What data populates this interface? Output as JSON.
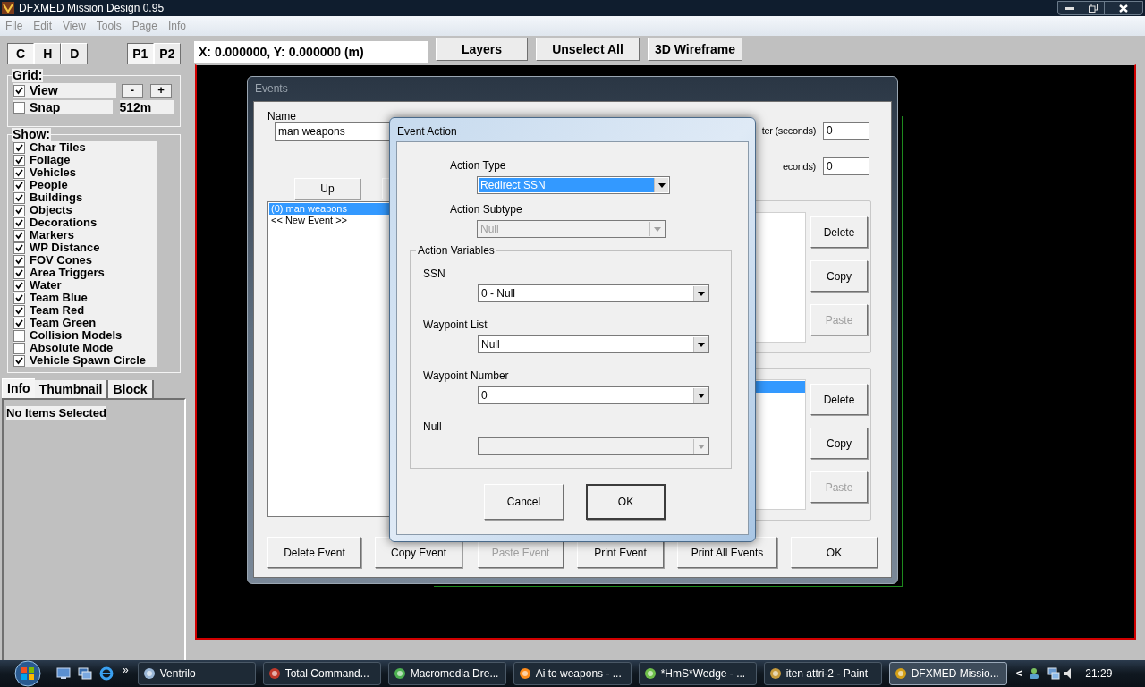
{
  "window": {
    "title": "DFXMED Mission Design 0.95"
  },
  "menu": [
    "File",
    "Edit",
    "View",
    "Tools",
    "Page",
    "Info"
  ],
  "modes": [
    {
      "label": "C",
      "selected": true
    },
    {
      "label": "H",
      "selected": false
    },
    {
      "label": "D",
      "selected": false
    }
  ],
  "pages": [
    {
      "label": "P1",
      "selected": true
    },
    {
      "label": "P2",
      "selected": false
    }
  ],
  "coordinates": "X: 0.000000, Y: 0.000000 (m)",
  "toolbar": [
    "Layers",
    "Unselect All",
    "3D Wireframe"
  ],
  "grid": {
    "title": "Grid:",
    "view": {
      "label": "View",
      "checked": true
    },
    "zoom_out": "-",
    "zoom_in": "+",
    "snap": {
      "label": "Snap",
      "checked": false
    },
    "size": "512m"
  },
  "show": {
    "title": "Show:",
    "items": [
      {
        "label": "Char Tiles",
        "checked": true
      },
      {
        "label": "Foliage",
        "checked": true
      },
      {
        "label": "Vehicles",
        "checked": true
      },
      {
        "label": "People",
        "checked": true
      },
      {
        "label": "Buildings",
        "checked": true
      },
      {
        "label": "Objects",
        "checked": true
      },
      {
        "label": "Decorations",
        "checked": true
      },
      {
        "label": "Markers",
        "checked": true
      },
      {
        "label": "WP Distance",
        "checked": true
      },
      {
        "label": "FOV Cones",
        "checked": true
      },
      {
        "label": "Area Triggers",
        "checked": true
      },
      {
        "label": "Water",
        "checked": true
      },
      {
        "label": "Team Blue",
        "checked": true
      },
      {
        "label": "Team Red",
        "checked": true
      },
      {
        "label": "Team Green",
        "checked": true
      },
      {
        "label": "Collision Models",
        "checked": false
      },
      {
        "label": "Absolute Mode",
        "checked": false
      },
      {
        "label": "Vehicle Spawn Circle",
        "checked": true
      }
    ]
  },
  "info_tabs": [
    {
      "label": "Info",
      "selected": true
    },
    {
      "label": "Thumbnail",
      "selected": false
    },
    {
      "label": "Block",
      "selected": false
    }
  ],
  "info_text": "No Items Selected",
  "events_dialog": {
    "title": "Events",
    "name_label": "Name",
    "name_value": "man weapons",
    "timers": [
      {
        "label": "ter (seconds)",
        "value": "0"
      },
      {
        "label": "econds)",
        "value": "0"
      }
    ],
    "up_button": "Up",
    "events": [
      {
        "label": "(0) man weapons",
        "selected": true
      },
      {
        "label": "<< New Event >>",
        "selected": false
      }
    ],
    "groups": [
      {
        "row_selected": false,
        "buttons": [
          {
            "label": "Delete",
            "disabled": false
          },
          {
            "label": "Copy",
            "disabled": false
          },
          {
            "label": "Paste",
            "disabled": true
          }
        ]
      },
      {
        "row_selected": true,
        "buttons": [
          {
            "label": "Delete",
            "disabled": false
          },
          {
            "label": "Copy",
            "disabled": false
          },
          {
            "label": "Paste",
            "disabled": true
          }
        ]
      }
    ],
    "bottom_buttons": [
      {
        "label": "Delete Event",
        "disabled": false
      },
      {
        "label": "Copy Event",
        "disabled": false
      },
      {
        "label": "Paste Event",
        "disabled": true
      },
      {
        "label": "Print Event",
        "disabled": false
      },
      {
        "label": "Print All Events",
        "disabled": false
      },
      {
        "label": "OK",
        "disabled": false
      }
    ]
  },
  "action_dialog": {
    "title": "Event Action",
    "action_type": {
      "label": "Action Type",
      "value": "Redirect SSN",
      "disabled": false,
      "focused": true
    },
    "action_subtype": {
      "label": "Action Subtype",
      "value": "Null",
      "disabled": true,
      "focused": false
    },
    "variables_title": "Action Variables",
    "variables": [
      {
        "label": "SSN",
        "value": "0 -  Null",
        "disabled": false,
        "focused": false
      },
      {
        "label": "Waypoint List",
        "value": "Null",
        "disabled": false,
        "focused": false
      },
      {
        "label": "Waypoint Number",
        "value": "0",
        "disabled": false,
        "focused": false
      },
      {
        "label": "Null",
        "disabled": true,
        "focused": false
      }
    ],
    "buttons": [
      {
        "label": "Cancel",
        "default": false
      },
      {
        "label": "OK",
        "default": true
      }
    ]
  },
  "taskbar": {
    "overflow": "»",
    "tasks": [
      {
        "label": "Ventrilo",
        "active": false
      },
      {
        "label": "Total Command...",
        "active": false
      },
      {
        "label": "Macromedia Dre...",
        "active": false
      },
      {
        "label": "Ai to weapons - ...",
        "active": false
      },
      {
        "label": "*HmS*Wedge - ...",
        "active": false
      },
      {
        "label": "iten attri-2 - Paint",
        "active": false
      },
      {
        "label": "DFXMED Missio...",
        "active": true
      }
    ],
    "tray_arrow": "<",
    "clock": "21:29"
  }
}
